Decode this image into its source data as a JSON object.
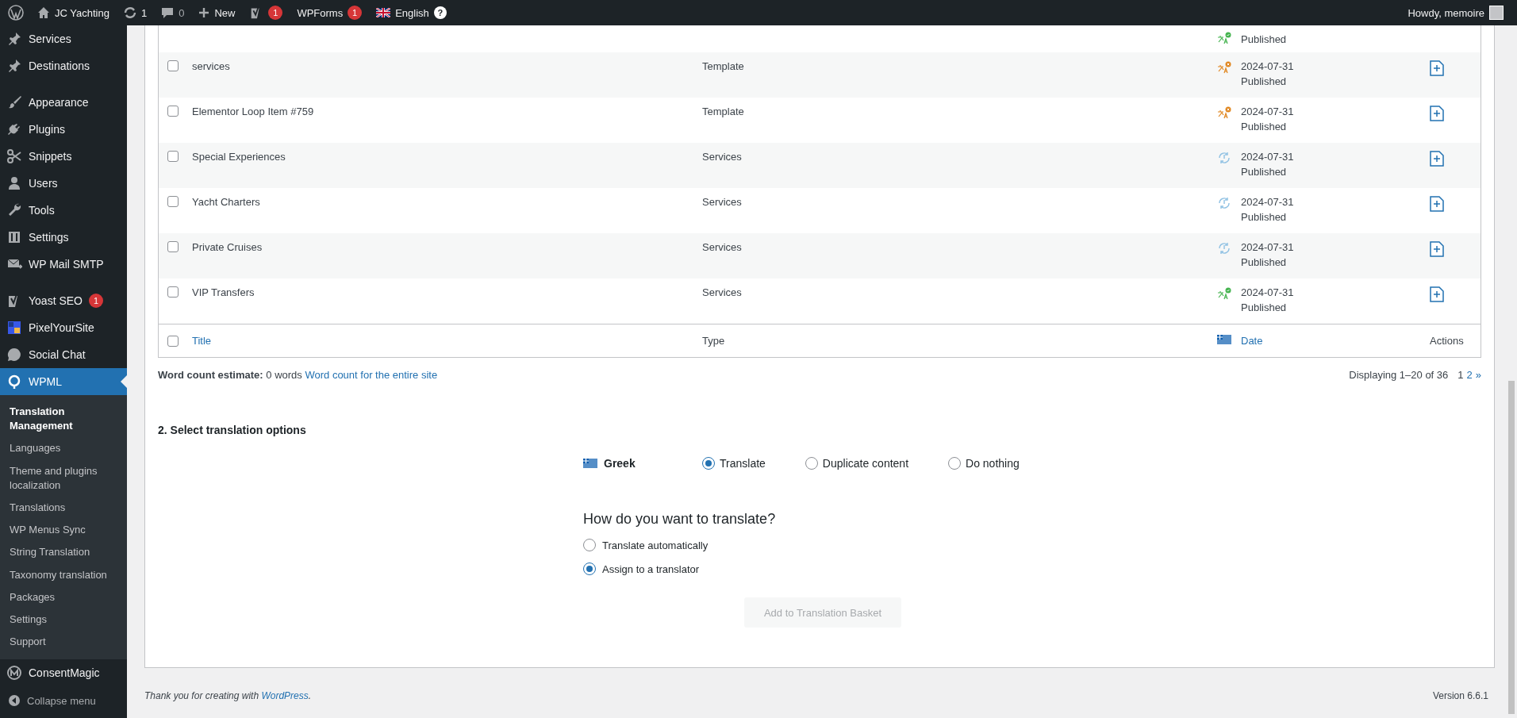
{
  "admin_bar": {
    "site": "JC Yachting",
    "updates": "1",
    "comments": "0",
    "new": "New",
    "seo_badge": "1",
    "forms": "WPForms",
    "forms_badge": "1",
    "language": "English",
    "help": "?",
    "greeting": "Howdy, memoire"
  },
  "sidebar": {
    "groups": [
      [
        {
          "label": "Services",
          "selected": false
        },
        {
          "label": "Destinations",
          "selected": false
        }
      ],
      [
        {
          "label": "Appearance",
          "selected": false
        },
        {
          "label": "Plugins",
          "selected": false
        },
        {
          "label": "Snippets",
          "selected": false
        },
        {
          "label": "Users",
          "selected": false
        },
        {
          "label": "Tools",
          "selected": false
        },
        {
          "label": "Settings",
          "selected": false
        },
        {
          "label": "WP Mail SMTP",
          "selected": false
        }
      ],
      [
        {
          "label": "Yoast SEO",
          "badge": "1",
          "selected": false
        },
        {
          "label": "PixelYourSite",
          "selected": false
        },
        {
          "label": "Social Chat",
          "selected": false
        },
        {
          "label": "WPML",
          "selected": true,
          "children": [
            {
              "label": "Translation Management",
              "selected": true
            },
            {
              "label": "Languages",
              "selected": false
            },
            {
              "label": "Theme and plugins localization",
              "selected": false
            },
            {
              "label": "Translations",
              "selected": false
            },
            {
              "label": "WP Menus Sync",
              "selected": false
            },
            {
              "label": "String Translation",
              "selected": false
            },
            {
              "label": "Taxonomy translation",
              "selected": false
            },
            {
              "label": "Packages",
              "selected": false
            },
            {
              "label": "Settings",
              "selected": false
            },
            {
              "label": "Support",
              "selected": false
            }
          ]
        },
        {
          "label": "ConsentMagic",
          "selected": false
        }
      ]
    ],
    "collapse": "Collapse menu"
  },
  "table": {
    "rows": [
      {
        "kind": "translated",
        "state": "Published"
      },
      {
        "kind": "not-translated",
        "checked": false,
        "title": "services",
        "type": "Template",
        "date": "2024-07-31",
        "state": "Published"
      },
      {
        "kind": "not-translated",
        "checked": false,
        "title": "Elementor Loop Item #759",
        "type": "Template",
        "date": "2024-07-31",
        "state": "Published"
      },
      {
        "kind": "in-progress",
        "checked": false,
        "title": "Special Experiences",
        "type": "Services",
        "date": "2024-07-31",
        "state": "Published"
      },
      {
        "kind": "in-progress",
        "checked": false,
        "title": "Yacht Charters",
        "type": "Services",
        "date": "2024-07-31",
        "state": "Published"
      },
      {
        "kind": "in-progress",
        "checked": false,
        "title": "Private Cruises",
        "type": "Services",
        "date": "2024-07-31",
        "state": "Published"
      },
      {
        "kind": "translated",
        "checked": false,
        "title": "VIP Transfers",
        "type": "Services",
        "date": "2024-07-31",
        "state": "Published"
      }
    ],
    "footer": {
      "checked": false,
      "title": "Title",
      "type": "Type",
      "date": "Date",
      "actions": "Actions"
    }
  },
  "word_count": {
    "label": "Word count estimate:",
    "value": "0 words",
    "link": "Word count for the entire site"
  },
  "pagination": {
    "summary": "Displaying 1–20 of 36",
    "pages": [
      {
        "label": "1",
        "selected": true
      },
      {
        "label": "2",
        "selected": false
      },
      {
        "label": "»",
        "selected": false
      }
    ]
  },
  "options": {
    "heading": "2. Select translation options",
    "language": "Greek",
    "choices": [
      {
        "label": "Translate",
        "selected": true
      },
      {
        "label": "Duplicate content",
        "selected": false
      },
      {
        "label": "Do nothing",
        "selected": false
      }
    ],
    "method_heading": "How do you want to translate?",
    "methods": [
      {
        "label": "Translate automatically",
        "selected": false
      },
      {
        "label": "Assign to a translator",
        "selected": true
      }
    ],
    "button": {
      "label": "Add to Translation Basket",
      "disabled": true
    }
  },
  "footer": {
    "text": "Thank you for creating with ",
    "link": "WordPress",
    "end": ".",
    "version": "Version 6.6.1"
  }
}
